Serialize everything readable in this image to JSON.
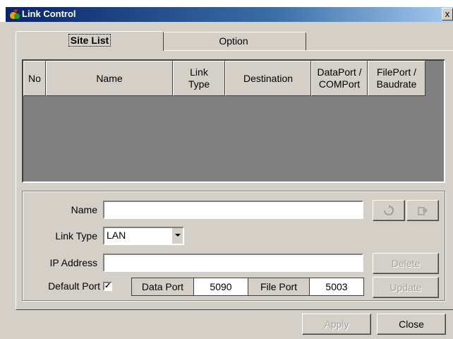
{
  "window": {
    "title": "Link Control",
    "close_glyph": "x"
  },
  "tabs": [
    {
      "label": "Site List",
      "active": true
    },
    {
      "label": "Option",
      "active": false
    }
  ],
  "site_table": {
    "columns": [
      "No",
      "Name",
      "Link\nType",
      "Destination",
      "DataPort /\nCOMPort",
      "FilePort /\nBaudrate"
    ],
    "rows": []
  },
  "form": {
    "name_label": "Name",
    "name_value": "",
    "link_type_label": "Link Type",
    "link_type_value": "LAN",
    "ip_label": "IP Address",
    "ip_value": "",
    "default_port_label": "Default Port",
    "default_port_checked": true,
    "check_glyph": "✓",
    "data_port_label": "Data Port",
    "data_port_value": "5090",
    "file_port_label": "File Port",
    "file_port_value": "5003"
  },
  "side_buttons": {
    "delete_label": "Delete",
    "update_label": "Update",
    "icon1": "refresh-icon",
    "icon2": "export-icon"
  },
  "footer": {
    "apply_label": "Apply",
    "close_label": "Close"
  },
  "colors": {
    "titlebar_start": "#0a246a",
    "titlebar_end": "#a6caf0",
    "grid_bg": "#808080",
    "face": "#d4d0c8"
  }
}
